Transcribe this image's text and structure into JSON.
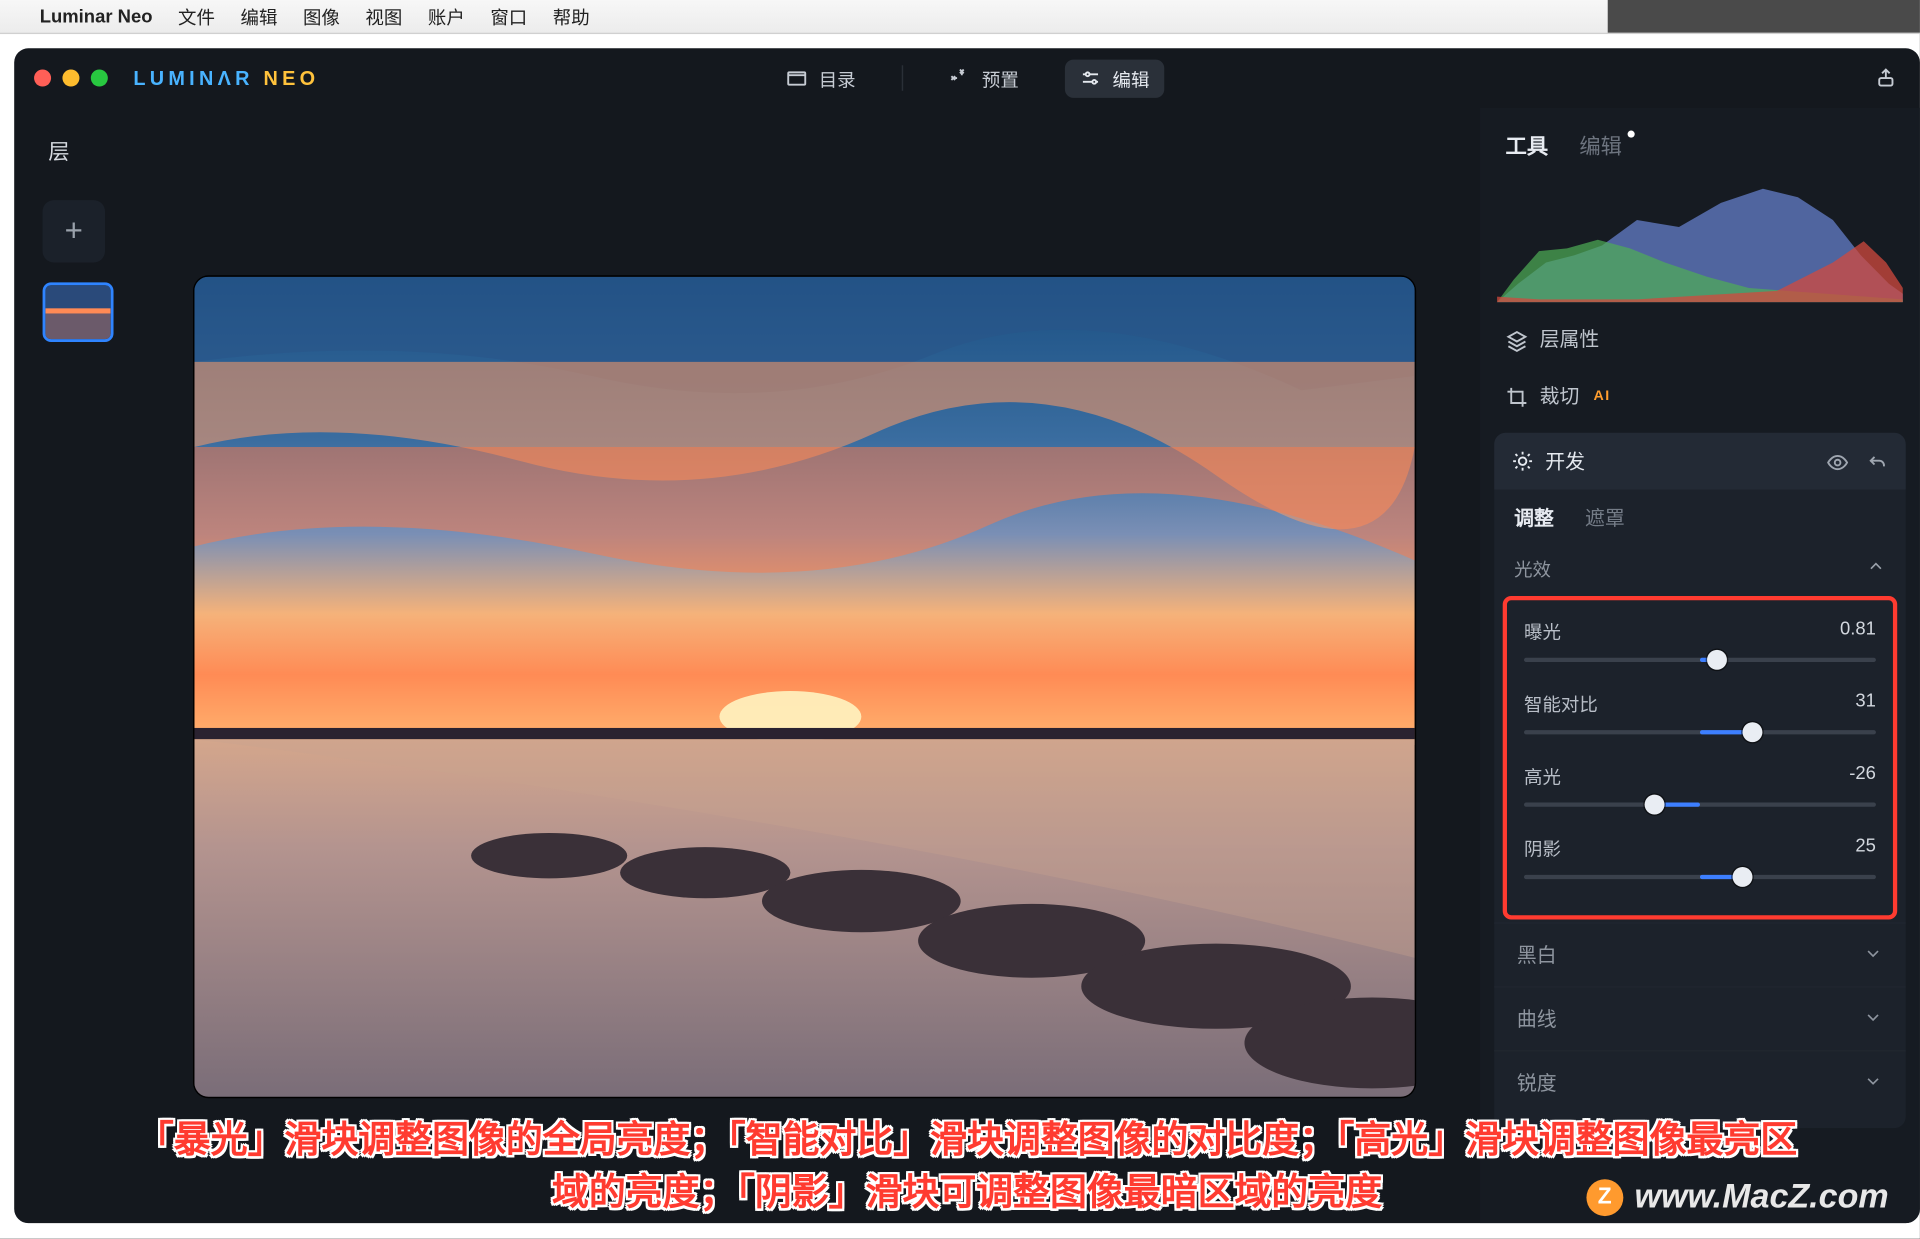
{
  "menubar": {
    "appname": "Luminar Neo",
    "items": [
      "文件",
      "编辑",
      "图像",
      "视图",
      "账户",
      "窗口",
      "帮助"
    ]
  },
  "logo": {
    "left": "LUMIN",
    "mid": "ɅR",
    "right": " NEO"
  },
  "titlebar": {
    "tabs": {
      "catalog": "目录",
      "presets": "预置",
      "edit": "编辑"
    }
  },
  "layers": {
    "label": "层"
  },
  "right": {
    "tabs": {
      "tools": "工具",
      "edits": "编辑"
    },
    "layer_props": "层属性",
    "crop": "裁切",
    "crop_ai": "AI",
    "develop": "开发",
    "subtabs": {
      "adjust": "调整",
      "mask": "遮罩"
    },
    "light_section": "光效",
    "sliders": [
      {
        "label": "曝光",
        "value": "0.81",
        "center": 50,
        "pos": 55
      },
      {
        "label": "智能对比",
        "value": "31",
        "center": 50,
        "pos": 65
      },
      {
        "label": "高光",
        "value": "-26",
        "center": 50,
        "pos": 37
      },
      {
        "label": "阴影",
        "value": "25",
        "center": 50,
        "pos": 62
      }
    ],
    "collapsed": [
      "黑白",
      "曲线",
      "锐度"
    ]
  },
  "caption": {
    "line1": "「暴光」滑块调整图像的全局亮度；「智能对比」滑块调整图像的对比度；「高光」滑块调整图像最亮区",
    "line2": "域的亮度；「阴影」滑块可调整图像最暗区域的亮度"
  },
  "watermark": "www.MacZ.com"
}
